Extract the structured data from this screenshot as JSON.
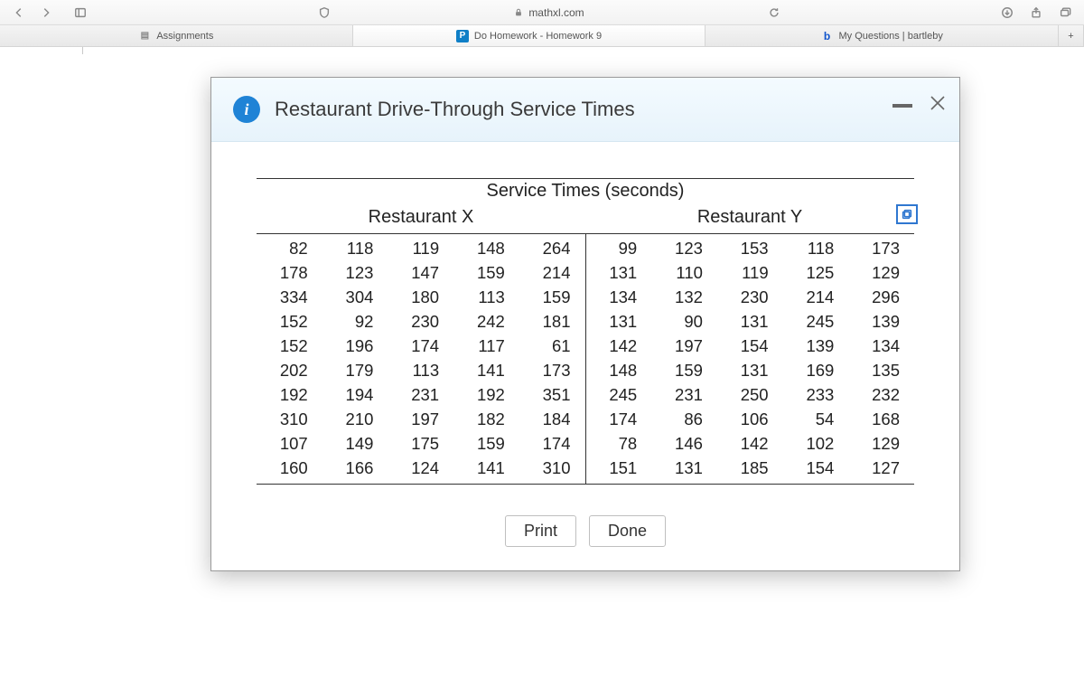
{
  "browser": {
    "url_host": "mathxl.com",
    "tabs": [
      {
        "label": "Assignments"
      },
      {
        "label": "Do Homework - Homework 9"
      },
      {
        "label": "My Questions | bartleby"
      }
    ]
  },
  "modal": {
    "title": "Restaurant Drive-Through Service Times",
    "table_title": "Service Times (seconds)",
    "header_x": "Restaurant X",
    "header_y": "Restaurant Y",
    "footer": {
      "print": "Print",
      "done": "Done"
    }
  },
  "chart_data": {
    "type": "table",
    "title": "Service Times (seconds)",
    "series": [
      {
        "name": "Restaurant X",
        "values_grid": [
          [
            82,
            118,
            119,
            148,
            264
          ],
          [
            178,
            123,
            147,
            159,
            214
          ],
          [
            334,
            304,
            180,
            113,
            159
          ],
          [
            152,
            92,
            230,
            242,
            181
          ],
          [
            152,
            196,
            174,
            117,
            61
          ],
          [
            202,
            179,
            113,
            141,
            173
          ],
          [
            192,
            194,
            231,
            192,
            351
          ],
          [
            310,
            210,
            197,
            182,
            184
          ],
          [
            107,
            149,
            175,
            159,
            174
          ],
          [
            160,
            166,
            124,
            141,
            310
          ]
        ]
      },
      {
        "name": "Restaurant Y",
        "values_grid": [
          [
            99,
            123,
            153,
            118,
            173
          ],
          [
            131,
            110,
            119,
            125,
            129
          ],
          [
            134,
            132,
            230,
            214,
            296
          ],
          [
            131,
            90,
            131,
            245,
            139
          ],
          [
            142,
            197,
            154,
            139,
            134
          ],
          [
            148,
            159,
            131,
            169,
            135
          ],
          [
            245,
            231,
            250,
            233,
            232
          ],
          [
            174,
            86,
            106,
            54,
            168
          ],
          [
            78,
            146,
            142,
            102,
            129
          ],
          [
            151,
            131,
            185,
            154,
            127
          ]
        ]
      }
    ]
  }
}
